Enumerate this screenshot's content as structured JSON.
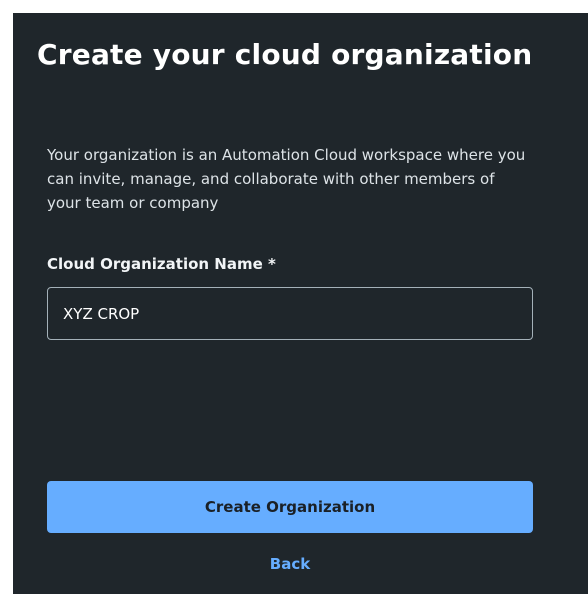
{
  "dialog": {
    "title": "Create your cloud organization",
    "description": "Your organization is an Automation Cloud workspace where you can invite, manage, and collaborate with other members of your team or company"
  },
  "form": {
    "org_name_label": "Cloud Organization Name *",
    "org_name_value": "XYZ CROP"
  },
  "actions": {
    "create_label": "Create Organization",
    "back_label": "Back"
  },
  "colors": {
    "panel_background": "#1f262b",
    "accent": "#66adff",
    "text_primary": "#ffffff"
  }
}
